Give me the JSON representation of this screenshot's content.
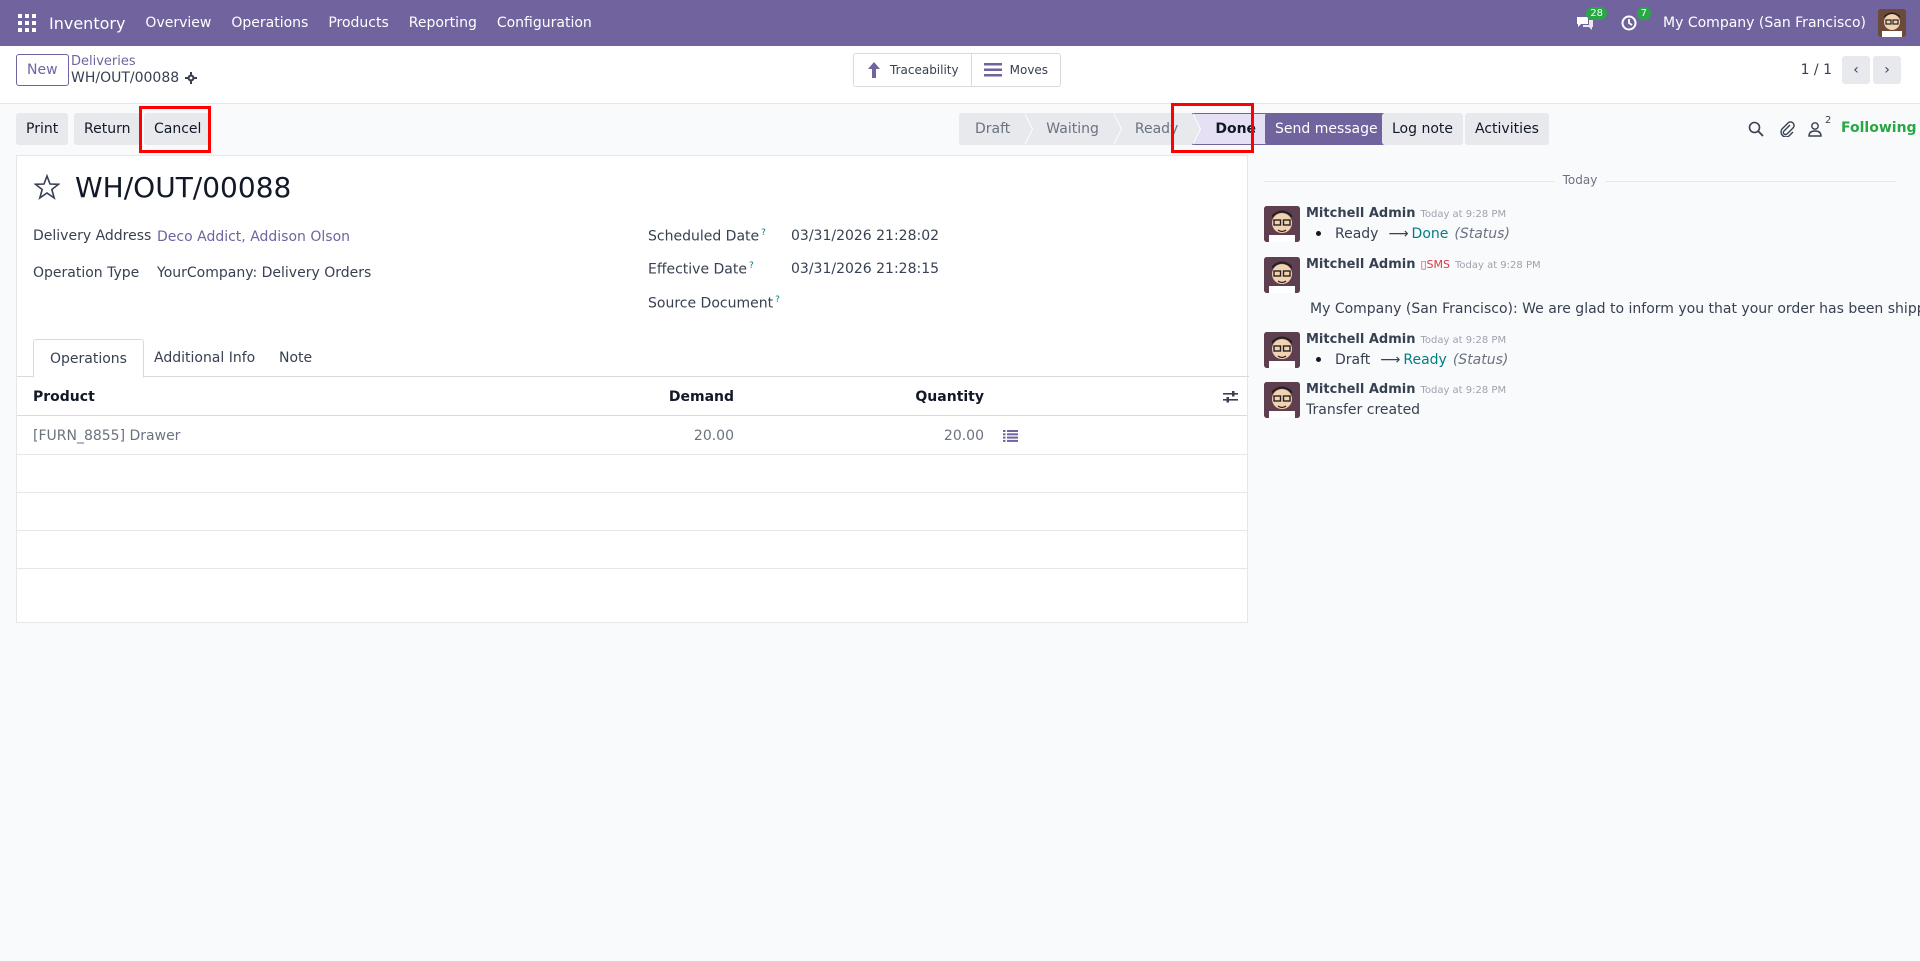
{
  "navbar": {
    "brand": "Inventory",
    "menu": [
      "Overview",
      "Operations",
      "Products",
      "Reporting",
      "Configuration"
    ],
    "messages_count": "28",
    "activities_count": "7",
    "company": "My Company (San Francisco)"
  },
  "control_panel": {
    "new_label": "New",
    "breadcrumb_parent": "Deliveries",
    "breadcrumb_current": "WH/OUT/00088",
    "smart_buttons": [
      "Traceability",
      "Moves"
    ],
    "pager": "1 / 1"
  },
  "actions": {
    "print": "Print",
    "return": "Return",
    "cancel": "Cancel"
  },
  "statusbar": {
    "stages": [
      "Draft",
      "Waiting",
      "Ready",
      "Done"
    ],
    "active": "Done"
  },
  "form": {
    "title": "WH/OUT/00088",
    "delivery_address_label": "Delivery Address",
    "delivery_address": "Deco Addict, Addison Olson",
    "operation_type_label": "Operation Type",
    "operation_type": "YourCompany: Delivery Orders",
    "scheduled_date_label": "Scheduled Date",
    "scheduled_date": "03/31/2026 21:28:02",
    "effective_date_label": "Effective Date",
    "effective_date": "03/31/2026 21:28:15",
    "source_document_label": "Source Document",
    "tabs": [
      "Operations",
      "Additional Info",
      "Note"
    ],
    "table": {
      "columns": [
        "Product",
        "Demand",
        "Quantity"
      ],
      "rows": [
        {
          "product": "[FURN_8855] Drawer",
          "demand": "20.00",
          "quantity": "20.00"
        }
      ]
    }
  },
  "chatter": {
    "send_message": "Send message",
    "log_note": "Log note",
    "activities": "Activities",
    "followers_count": "2",
    "following": "Following",
    "today": "Today",
    "messages": [
      {
        "author": "Mitchell Admin",
        "time": "Today at 9:28 PM",
        "old": "Ready",
        "new": "Done",
        "field": "(Status)"
      },
      {
        "author": "Mitchell Admin",
        "sms": "SMS",
        "time": "Today at 9:28 PM",
        "body": "My Company (San Francisco): We are glad to inform you that your order has been shipped."
      },
      {
        "author": "Mitchell Admin",
        "time": "Today at 9:28 PM",
        "old": "Draft",
        "new": "Ready",
        "field": "(Status)"
      },
      {
        "author": "Mitchell Admin",
        "time": "Today at 9:28 PM",
        "body": "Transfer created"
      }
    ]
  },
  "colors": {
    "brand": "#71639e",
    "link": "#017e84",
    "following": "#28a745",
    "highlight": "#ff0000"
  }
}
